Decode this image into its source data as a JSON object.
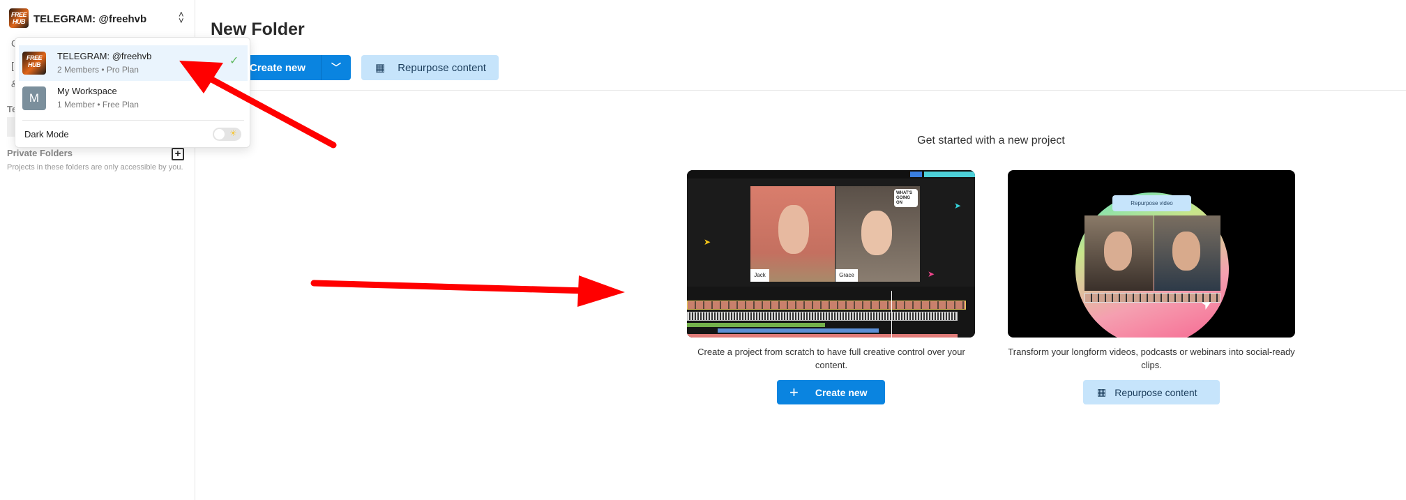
{
  "sidebar": {
    "workspace_name": "TELEGRAM: @freehvb",
    "logo_text": "FREE HUB",
    "private_folders_label": "Private Folders",
    "private_folders_hint": "Projects in these folders are only accessible by you."
  },
  "dropdown": {
    "workspaces": [
      {
        "name": "TELEGRAM: @freehvb",
        "meta": "2 Members • Pro Plan",
        "selected": true
      },
      {
        "name": "My Workspace",
        "meta": "1 Member • Free Plan",
        "initial": "M",
        "selected": false
      }
    ],
    "dark_mode_label": "Dark Mode",
    "dark_mode_on": false
  },
  "header": {
    "title": "New Folder",
    "create_new_label": "Create new",
    "repurpose_label": "Repurpose content"
  },
  "get_started": {
    "heading": "Get started with a new project",
    "cards": [
      {
        "description": "Create a project from scratch to have full creative control over your content.",
        "button": "Create new",
        "preview": {
          "speaker_1": "Jack",
          "speaker_2": "Grace",
          "bubble": "WHAT'S GOING ON"
        }
      },
      {
        "description": "Transform your longform videos, podcasts or webinars into social-ready clips.",
        "button": "Repurpose content",
        "preview": {
          "pill": "Repurpose video"
        }
      }
    ]
  },
  "colors": {
    "primary": "#0a84e0",
    "secondary_bg": "#c6e4fb",
    "annotation_arrow": "#ff0000",
    "check": "#5cb85c"
  }
}
